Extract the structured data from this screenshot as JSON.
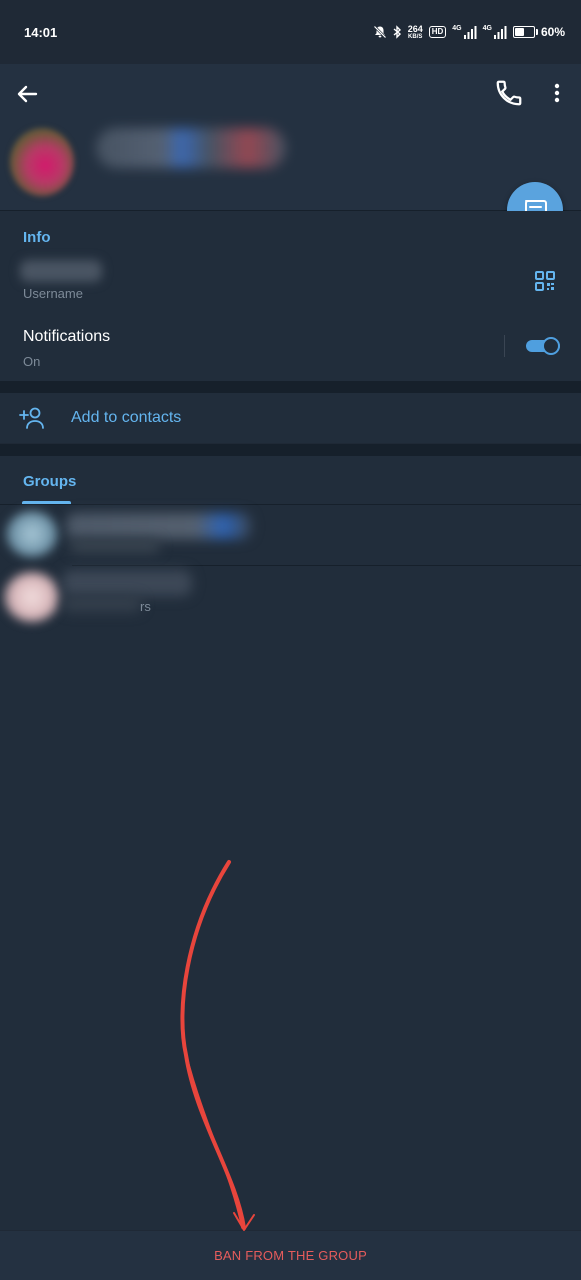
{
  "status_bar": {
    "time": "14:01",
    "net_speed_value": "264",
    "net_speed_unit": "KB/S",
    "hd_label": "HD",
    "sim1_label": "4G",
    "sim2_label": "4G",
    "battery_percent": "60%",
    "battery_level": 0.6,
    "icons": [
      "mute-bell-icon",
      "bluetooth-icon",
      "hd-icon",
      "signal-icon",
      "signal-icon",
      "battery-icon"
    ]
  },
  "header": {
    "icons": [
      "back-arrow-icon",
      "phone-icon",
      "more-vertical-icon",
      "message-icon"
    ]
  },
  "info": {
    "title": "Info",
    "username_caption": "Username",
    "notifications_label": "Notifications",
    "notifications_status": "On",
    "notifications_enabled": true,
    "qr_icon": "qr-code-icon"
  },
  "add_contact": {
    "label": "Add to contacts",
    "icon": "add-person-icon"
  },
  "groups": {
    "tab_label": "Groups",
    "row2_partial_subtitle": "rs"
  },
  "action": {
    "ban_label": "BAN FROM THE GROUP",
    "color": "#e55c5c"
  },
  "colors": {
    "background": "#1f2936",
    "accent": "#64b5ef",
    "fab": "#5aa3de",
    "annotation_arrow": "#e8453c"
  }
}
